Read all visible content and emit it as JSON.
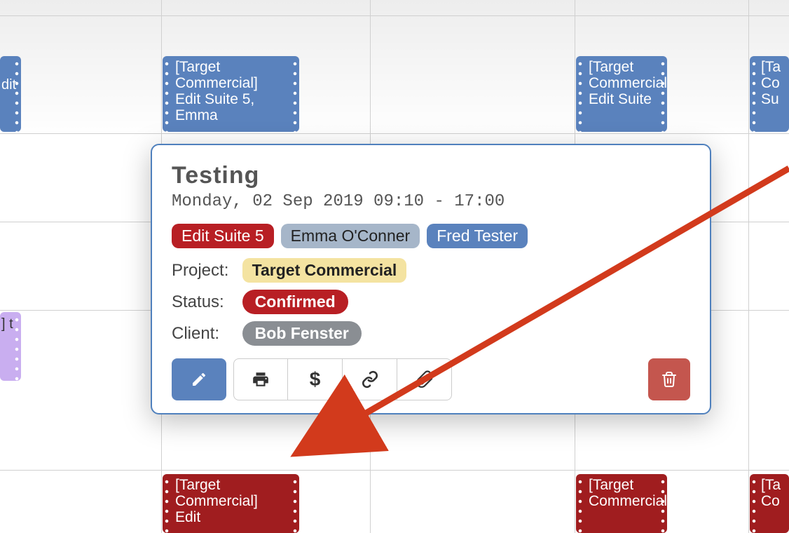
{
  "events": {
    "blue_left_trunc": "dit",
    "blue_1": "[Target Commercial] Edit Suite 5, Emma",
    "blue_2": "[Target Commercial] Edit Suite",
    "blue_3": "[Ta Co Su",
    "purple_left": "] t",
    "red_1": "[Target Commercial] Edit",
    "red_2": "[Target Commercial]",
    "red_3": "[Ta Co"
  },
  "popup": {
    "title": "Testing",
    "datetime": "Monday, 02 Sep 2019 09:10 - 17:00",
    "room": "Edit Suite 5",
    "person1": "Emma O'Conner",
    "person2": "Fred Tester",
    "labels": {
      "project": "Project:",
      "status": "Status:",
      "client": "Client:"
    },
    "project": "Target Commercial",
    "status": "Confirmed",
    "client": "Bob Fenster"
  },
  "icons": {
    "edit": "edit-icon",
    "print": "print-icon",
    "dollar": "dollar-icon",
    "link": "link-icon",
    "attach": "paperclip-icon",
    "trash": "trash-icon"
  }
}
